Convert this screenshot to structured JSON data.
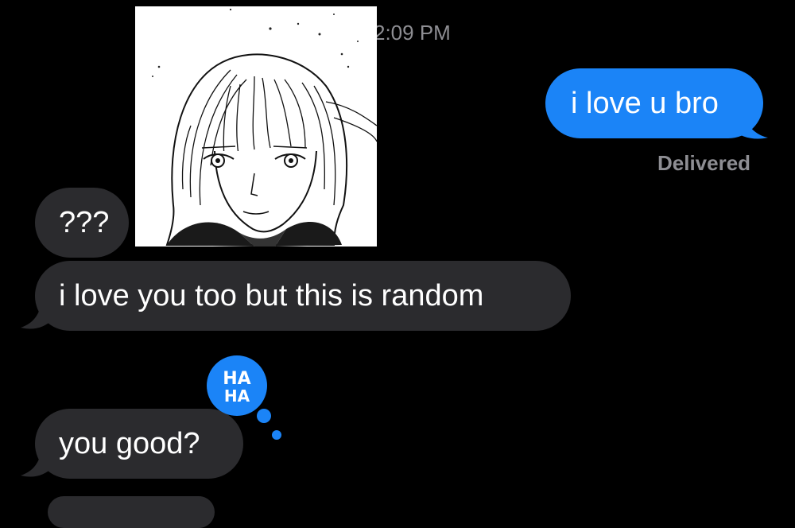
{
  "thread": {
    "timestamp": "2:09 PM",
    "messages": [
      {
        "direction": "outgoing",
        "text": "i love u bro"
      },
      {
        "direction": "incoming",
        "text": "???"
      },
      {
        "direction": "incoming",
        "text": "i love you too but this is random"
      },
      {
        "direction": "incoming",
        "text": "you good?",
        "tapback": "HA HA"
      }
    ],
    "status": "Delivered"
  },
  "tapback": {
    "line1": "HA",
    "line2": "HA"
  },
  "colors": {
    "outgoing_bubble": "#1b84f7",
    "incoming_bubble": "#2b2b2e",
    "meta_text": "#8e8e93"
  },
  "icons": {
    "avatar": "contact-photo-manga-girl",
    "reaction": "haha-tapback-icon"
  }
}
